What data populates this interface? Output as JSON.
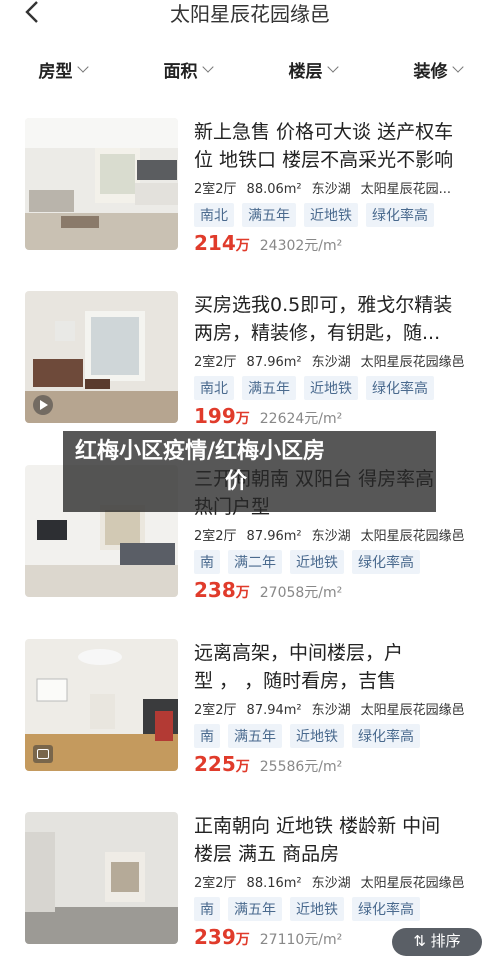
{
  "header": {
    "title": "太阳星辰花园缘邑"
  },
  "filters": [
    {
      "label": "房型"
    },
    {
      "label": "面积"
    },
    {
      "label": "楼层"
    },
    {
      "label": "装修"
    }
  ],
  "listings": [
    {
      "title_line1": "新上急售 价格可大谈 送产权车",
      "title_line2": "位 地铁口 楼层不高采光不影响",
      "layout": "2室2厅",
      "area": "88.06m²",
      "district": "东沙湖",
      "community": "太阳星辰花园...",
      "tags": [
        "南北",
        "满五年",
        "近地铁",
        "绿化率高"
      ],
      "total": "214",
      "unit": "万",
      "per": "24302元/m²",
      "media_icon": "none"
    },
    {
      "title_line1": "买房选我0.5即可，雅戈尔精装",
      "title_line2": "两房，精装修，有钥匙，随...",
      "layout": "2室2厅",
      "area": "87.96m²",
      "district": "东沙湖",
      "community": "太阳星辰花园缘邑",
      "tags": [
        "南北",
        "满五年",
        "近地铁",
        "绿化率高"
      ],
      "total": "199",
      "unit": "万",
      "per": "22624元/m²",
      "media_icon": "play-icon"
    },
    {
      "title_line1": "三开间朝南 双阳台 得房率高",
      "title_line2": "热门户型",
      "layout": "2室2厅",
      "area": "87.96m²",
      "district": "东沙湖",
      "community": "太阳星辰花园缘邑",
      "tags": [
        "南",
        "满二年",
        "近地铁",
        "绿化率高"
      ],
      "total": "238",
      "unit": "万",
      "per": "27058元/m²",
      "media_icon": "none"
    },
    {
      "title_line1": "远离高架，中间楼层，户",
      "title_line2": "型 ，    ，随时看房，吉售",
      "layout": "2室2厅",
      "area": "87.94m²",
      "district": "东沙湖",
      "community": "太阳星辰花园缘邑",
      "tags": [
        "南",
        "满五年",
        "近地铁",
        "绿化率高"
      ],
      "total": "225",
      "unit": "万",
      "per": "25586元/m²",
      "media_icon": "vr-icon"
    },
    {
      "title_line1": "正南朝向 近地铁 楼龄新 中间",
      "title_line2": "楼层 满五 商品房",
      "layout": "2室2厅",
      "area": "88.16m²",
      "district": "东沙湖",
      "community": "太阳星辰花园缘邑",
      "tags": [
        "南",
        "满五年",
        "近地铁",
        "绿化率高"
      ],
      "total": "239",
      "unit": "万",
      "per": "27110元/m²",
      "media_icon": "none"
    }
  ],
  "overlay": {
    "line1": "红梅小区疫情/红梅小区房",
    "line2": "价"
  },
  "sort_button": {
    "label": "⇅ 排序"
  },
  "colors": {
    "price": "#e03b2b",
    "tag_bg": "#eef3f9",
    "tag_text": "#4a6a8e"
  }
}
